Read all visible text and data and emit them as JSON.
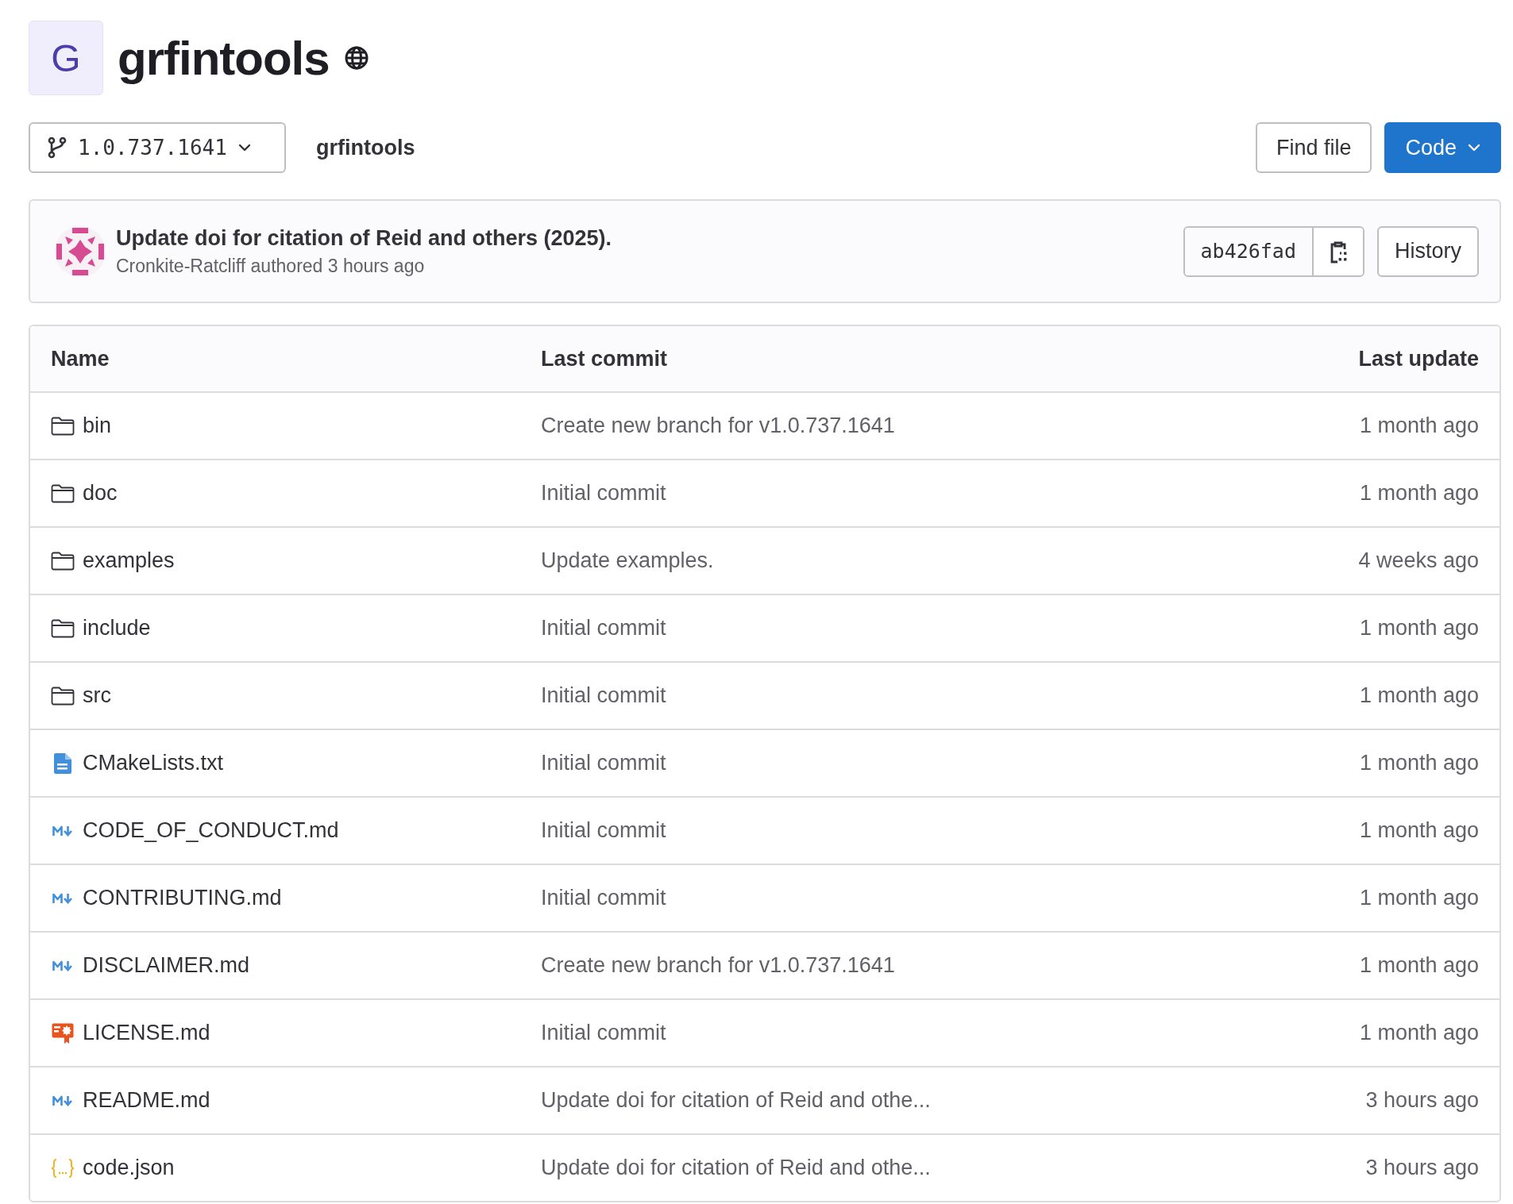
{
  "project": {
    "avatar_letter": "G",
    "name": "grfintools",
    "public": true
  },
  "toolbar": {
    "branch": "1.0.737.1641",
    "breadcrumb": "grfintools",
    "buttons": [
      {
        "label": "Find file",
        "kind": "default"
      },
      {
        "label": "Code",
        "kind": "primary"
      }
    ]
  },
  "last_commit": {
    "title": "Update doi for citation of Reid and others (2025).",
    "byline": "Cronkite-Ratcliff authored 3 hours ago",
    "sha": "ab426fad",
    "history_button": "History"
  },
  "table": {
    "columns": [
      "Name",
      "Last commit",
      "Last update"
    ],
    "rows": [
      {
        "kind": "folder",
        "name": "bin",
        "commit": "Create new branch for v1.0.737.1641",
        "updated": "1 month ago"
      },
      {
        "kind": "folder",
        "name": "doc",
        "commit": "Initial commit",
        "updated": "1 month ago"
      },
      {
        "kind": "folder",
        "name": "examples",
        "commit": "Update examples.",
        "updated": "4 weeks ago"
      },
      {
        "kind": "folder",
        "name": "include",
        "commit": "Initial commit",
        "updated": "1 month ago"
      },
      {
        "kind": "folder",
        "name": "src",
        "commit": "Initial commit",
        "updated": "1 month ago"
      },
      {
        "kind": "text",
        "name": "CMakeLists.txt",
        "commit": "Initial commit",
        "updated": "1 month ago"
      },
      {
        "kind": "markdown",
        "name": "CODE_OF_CONDUCT.md",
        "commit": "Initial commit",
        "updated": "1 month ago"
      },
      {
        "kind": "markdown",
        "name": "CONTRIBUTING.md",
        "commit": "Initial commit",
        "updated": "1 month ago"
      },
      {
        "kind": "markdown",
        "name": "DISCLAIMER.md",
        "commit": "Create new branch for v1.0.737.1641",
        "updated": "1 month ago"
      },
      {
        "kind": "license",
        "name": "LICENSE.md",
        "commit": "Initial commit",
        "updated": "1 month ago"
      },
      {
        "kind": "markdown",
        "name": "README.md",
        "commit": "Update doi for citation of Reid and othe...",
        "updated": "3 hours ago"
      },
      {
        "kind": "json",
        "name": "code.json",
        "commit": "Update doi for citation of Reid and othe...",
        "updated": "3 hours ago"
      }
    ]
  }
}
